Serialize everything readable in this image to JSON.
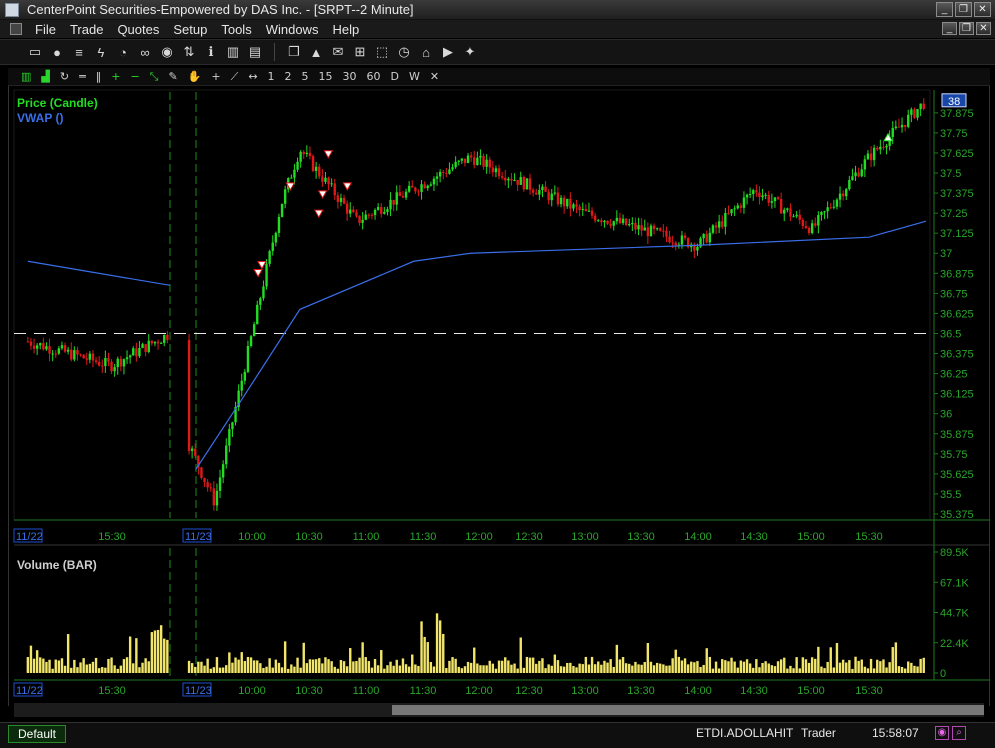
{
  "window": {
    "title": "CenterPoint Securities-Empowered by DAS Inc. - [SRPT--2 Minute]",
    "buttons": [
      "_",
      "❐",
      "✕"
    ]
  },
  "menubar": {
    "items": [
      "File",
      "Trade",
      "Quotes",
      "Setup",
      "Tools",
      "Windows",
      "Help"
    ],
    "mdi_buttons": [
      "_",
      "❐",
      "✕"
    ]
  },
  "toolbar": {
    "icons": [
      "window-icon",
      "user-icon",
      "list-icon",
      "lightning-icon",
      "clock-icon",
      "link-icon",
      "eye-icon",
      "sort-icon",
      "info-icon",
      "chart-icon",
      "note-icon",
      "copy-icon",
      "alert-icon",
      "mail-icon",
      "network-icon",
      "select-icon",
      "clock2-icon",
      "home-icon",
      "youtube-icon",
      "twitter-icon"
    ]
  },
  "chart_toolbar": {
    "intervals": [
      "1",
      "2",
      "5",
      "15",
      "30",
      "60",
      "D",
      "W"
    ]
  },
  "chart": {
    "price_series_label": "Price (Candle)",
    "vwap_label": "VWAP ()",
    "volume_label": "Volume (BAR)",
    "price_label_color": "#22dd22",
    "vwap_color": "#3a6ee8",
    "up_color": "#22dd22",
    "down_color": "#e01818",
    "volume_color": "#f2e66a",
    "axis_text_color": "#2aa52a",
    "last_price_tag": "38",
    "price_ticks": [
      "37.875",
      "37.75",
      "37.625",
      "37.5",
      "37.375",
      "37.25",
      "37.125",
      "37",
      "36.875",
      "36.75",
      "36.625",
      "36.5",
      "36.375",
      "36.25",
      "36.125",
      "36",
      "35.875",
      "35.75",
      "35.625",
      "35.5",
      "35.375"
    ],
    "volume_ticks": [
      "89.5K",
      "67.1K",
      "44.7K",
      "22.4K",
      "0"
    ],
    "date_labels": [
      "11/22",
      "11/23"
    ],
    "time_labels": [
      "15:30",
      "10:00",
      "10:30",
      "11:00",
      "11:30",
      "12:00",
      "12:30",
      "13:00",
      "13:30",
      "14:00",
      "14:30",
      "15:00",
      "15:30"
    ],
    "reference_line_price": 36.5
  },
  "chart_data": {
    "type": "candlestick",
    "symbol": "SRPT",
    "interval": "2 Minute",
    "price_range": [
      35.35,
      37.98
    ],
    "volume_range": [
      0,
      89500
    ],
    "key_points": [
      {
        "t": "11/22 15:00",
        "price": 36.45
      },
      {
        "t": "11/22 15:35",
        "price": 36.3
      },
      {
        "t": "11/22 16:00",
        "price": 36.5
      },
      {
        "t": "11/23 09:30",
        "price": 35.85
      },
      {
        "t": "11/23 09:45",
        "price": 35.45
      },
      {
        "t": "11/23 10:20",
        "price": 37.3
      },
      {
        "t": "11/23 10:30",
        "price": 37.65
      },
      {
        "t": "11/23 11:00",
        "price": 37.2
      },
      {
        "t": "11/23 12:00",
        "price": 37.6
      },
      {
        "t": "11/23 13:00",
        "price": 37.25
      },
      {
        "t": "11/23 14:00",
        "price": 37.05
      },
      {
        "t": "11/23 14:30",
        "price": 37.4
      },
      {
        "t": "11/23 15:00",
        "price": 37.15
      },
      {
        "t": "11/23 15:30",
        "price": 37.6
      },
      {
        "t": "11/23 16:00",
        "price": 37.95
      }
    ],
    "vwap_points": [
      {
        "t": "11/22 15:00",
        "price": 36.95
      },
      {
        "t": "11/22 16:00",
        "price": 36.8
      },
      {
        "t": "11/23 09:35",
        "price": 35.65
      },
      {
        "t": "11/23 10:00",
        "price": 36.1
      },
      {
        "t": "11/23 10:30",
        "price": 36.65
      },
      {
        "t": "11/23 11:30",
        "price": 36.95
      },
      {
        "t": "11/23 12:00",
        "price": 37.0
      },
      {
        "t": "11/23 14:00",
        "price": 37.05
      },
      {
        "t": "11/23 15:30",
        "price": 37.1
      },
      {
        "t": "11/23 16:00",
        "price": 37.2
      }
    ],
    "max_volume": 89500
  },
  "status": {
    "tab": "Default",
    "user": "ETDI.ADOLLAHIT",
    "role": "Trader",
    "time": "15:58:07"
  }
}
